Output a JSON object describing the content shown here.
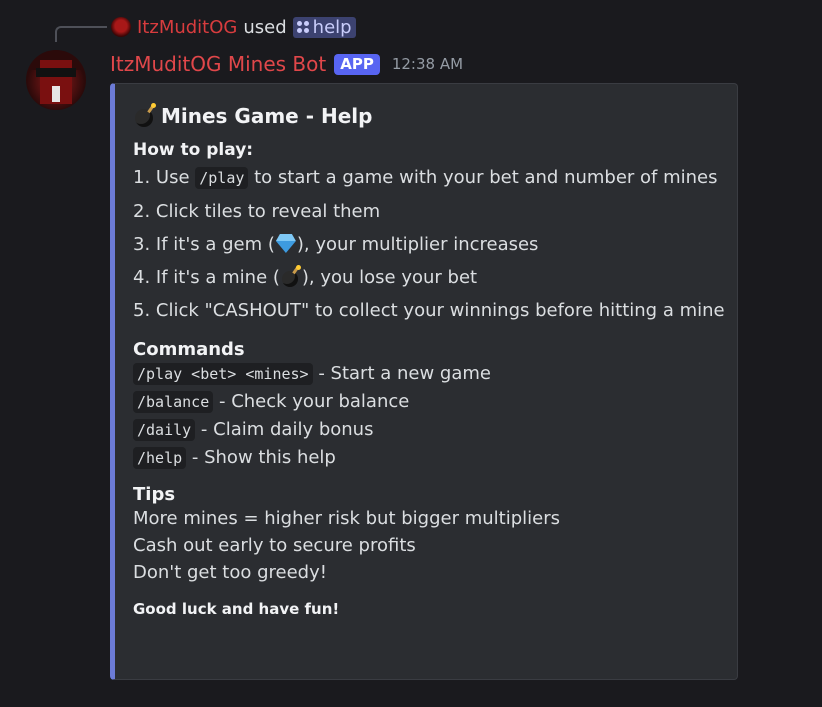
{
  "reply": {
    "username": "ItzMuditOG",
    "used_text": "used",
    "command": "help"
  },
  "message": {
    "bot_name": "ItzMuditOG Mines Bot",
    "badge": "APP",
    "timestamp": "12:38 AM"
  },
  "embed": {
    "accent_color": "#6c7bd6",
    "title": "Mines Game - Help",
    "how_to_play_heading": "How to play:",
    "steps": {
      "s1_pre": "1. Use ",
      "s1_code": "/play",
      "s1_post": " to start a game with your bet and number of mines",
      "s2": "2. Click tiles to reveal them",
      "s3_pre": "3. If it's a gem (",
      "s3_post": "), your multiplier increases",
      "s4_pre": "4. If it's a mine (",
      "s4_post": "), you lose your bet",
      "s5": "5. Click \"CASHOUT\" to collect your winnings before hitting a mine"
    },
    "commands_heading": "Commands",
    "commands": [
      {
        "code": "/play <bet> <mines>",
        "desc": " - Start a new game"
      },
      {
        "code": "/balance",
        "desc": " - Check your balance"
      },
      {
        "code": "/daily",
        "desc": " - Claim daily bonus"
      },
      {
        "code": "/help",
        "desc": " - Show this help"
      }
    ],
    "tips_heading": "Tips",
    "tips": [
      "More mines = higher risk but bigger multipliers",
      "Cash out early to secure profits",
      "Don't get too greedy!"
    ],
    "footer": "Good luck and have fun!"
  },
  "icons": {
    "title_icon": "bomb-icon",
    "gem": "gem-icon",
    "mine": "bomb-icon",
    "command": "slash-command-icon"
  }
}
